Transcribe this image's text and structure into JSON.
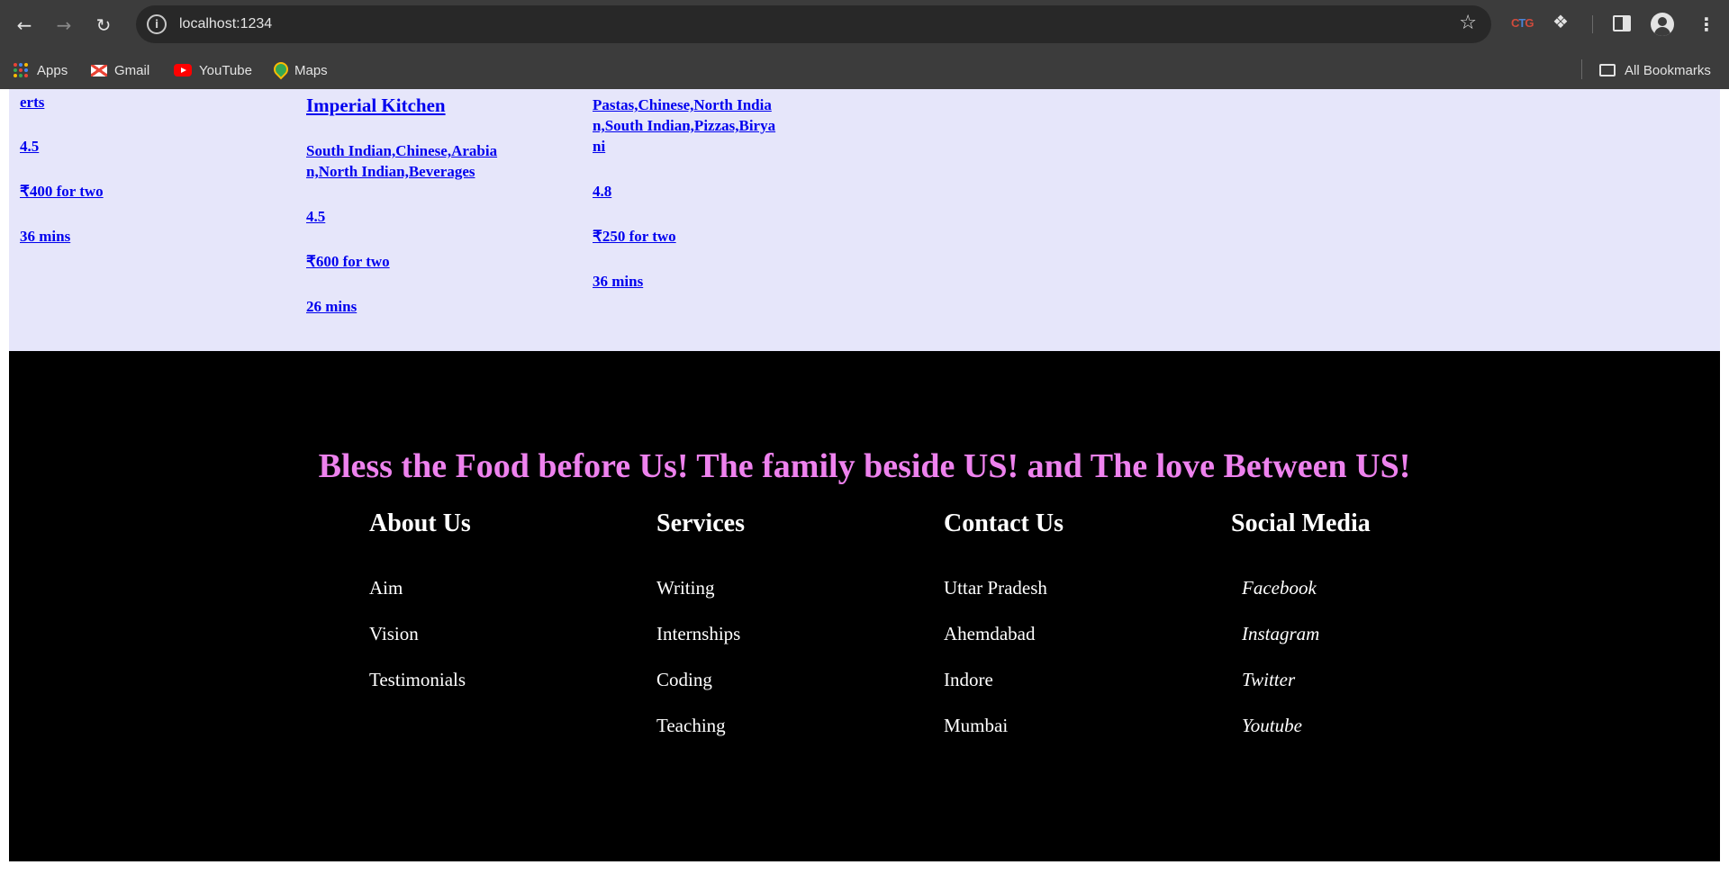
{
  "browser": {
    "url": "localhost:1234",
    "icons": {
      "back": "arrow-left-icon",
      "forward": "arrow-right-icon",
      "reload": "reload-icon",
      "site_info": "info-icon",
      "bookmark_star": "star-icon",
      "extensions": "puzzle-icon",
      "side_panel": "side-panel-icon",
      "profile": "profile-icon",
      "menu": "kebab-menu-icon"
    },
    "bookmarks": [
      {
        "label": "Apps"
      },
      {
        "label": "Gmail"
      },
      {
        "label": "YouTube"
      },
      {
        "label": "Maps"
      }
    ],
    "all_bookmarks_label": "All Bookmarks"
  },
  "restaurants": [
    {
      "name_fragment": "erts",
      "rating": "4.5",
      "cost": "₹400 for two",
      "delivery_time": "36 mins"
    },
    {
      "name": "Imperial Kitchen",
      "cuisines_line1": "South Indian,Chinese,Arabia",
      "cuisines_line2": "n,North Indian,Beverages",
      "rating": "4.5",
      "cost": "₹600 for two",
      "delivery_time": "26 mins"
    },
    {
      "cuisines_line1": "Pastas,Chinese,North India",
      "cuisines_line2": "n,South Indian,Pizzas,Birya",
      "cuisines_line3": "ni",
      "rating": "4.8",
      "cost": "₹250 for two",
      "delivery_time": "36 mins"
    }
  ],
  "footer": {
    "quote": "Bless the Food before Us! The family beside US! and The love Between US!",
    "quote_color": "#ee82ee",
    "columns": [
      {
        "heading": "About Us",
        "items": [
          "Aim",
          "Vision",
          "Testimonials"
        ]
      },
      {
        "heading": "Services",
        "items": [
          "Writing",
          "Internships",
          "Coding",
          "Teaching"
        ]
      },
      {
        "heading": "Contact Us",
        "items": [
          "Uttar Pradesh",
          "Ahemdabad",
          "Indore",
          "Mumbai"
        ]
      },
      {
        "heading": "Social Media",
        "items": [
          "Facebook",
          "Instagram",
          "Twitter",
          "Youtube"
        ]
      }
    ]
  },
  "colors": {
    "section_bg": "#e6e6fa",
    "link": "#0000ee",
    "footer_bg": "#000000"
  }
}
